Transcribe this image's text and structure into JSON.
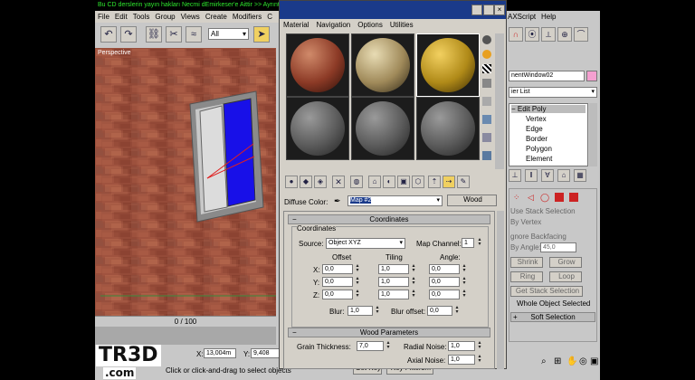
{
  "banner": "Bu CD derslerin yayın hakları Necmi dEmirkeser'e Aittir >> Ayrıntılı bilgi için  www.tr3d.com",
  "menubar": [
    "File",
    "Edit",
    "Tools",
    "Group",
    "Views",
    "Create",
    "Modifiers",
    "C"
  ],
  "toolbar": {
    "selection_filter": "All"
  },
  "viewport": {
    "label": "Perspective"
  },
  "timeslider": "0 / 100",
  "status": {
    "prompt": "Click or click-and-drag to select objects",
    "x": "13,004m",
    "y": "9,408",
    "set_key": "Set Key",
    "key_filters": "Key Filters..."
  },
  "material_editor": {
    "menu": [
      "Material",
      "Navigation",
      "Options",
      "Utilities"
    ],
    "diffuse_label": "Diffuse Color:",
    "map_name": "Map #2",
    "map_type": "Wood",
    "coordinates": {
      "title": "Coordinates",
      "group": "Coordinates",
      "source_label": "Source:",
      "source_value": "Object XYZ",
      "map_channel_label": "Map Channel:",
      "map_channel_value": "1",
      "headers": [
        "Offset",
        "Tiling",
        "Angle:"
      ],
      "rows": [
        {
          "axis": "X:",
          "offset": "0,0",
          "tiling": "1,0",
          "angle": "0,0"
        },
        {
          "axis": "Y:",
          "offset": "0,0",
          "tiling": "1,0",
          "angle": "0,0"
        },
        {
          "axis": "Z:",
          "offset": "0,0",
          "tiling": "1,0",
          "angle": "0,0"
        }
      ],
      "blur_label": "Blur:",
      "blur_value": "1,0",
      "blur_offset_label": "Blur offset:",
      "blur_offset_value": "0,0"
    },
    "wood": {
      "title": "Wood Parameters",
      "grain_label": "Grain Thickness:",
      "grain_value": "7,0",
      "radial_label": "Radial Noise:",
      "radial_value": "1,0",
      "axial_label": "Axial Noise:",
      "axial_value": "1,0"
    }
  },
  "command_panel": {
    "maxscript": "AXScript",
    "help": "Help",
    "object_name": "nentWindow02",
    "modifier_list": "ier List",
    "stack": [
      "Edit Poly",
      "Vertex",
      "Edge",
      "Border",
      "Polygon",
      "Element"
    ],
    "use_stack_selection": "Use Stack Selection",
    "by_vertex": "By Vertex",
    "ignore_backfacing": "gnore Backfacing",
    "by_angle": "By Angle:",
    "by_angle_value": "45,0",
    "shrink": "Shrink",
    "grow": "Grow",
    "ring": "Ring",
    "loop": "Loop",
    "get_stack_selection": "Get Stack Selection",
    "whole_object_selected": "Whole Object Selected",
    "soft_selection": "Soft Selection"
  },
  "logo": {
    "line1": "TR3D",
    "line2": ".com"
  }
}
